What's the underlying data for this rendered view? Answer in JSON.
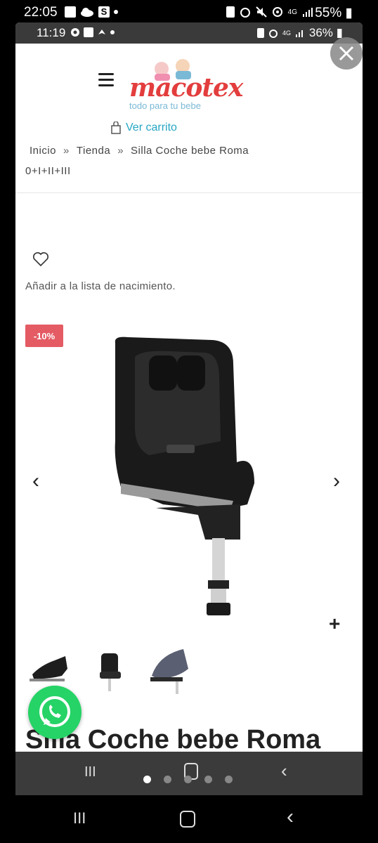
{
  "outer_status": {
    "time": "22:05",
    "battery": "55%"
  },
  "inner_status": {
    "time": "11:19",
    "battery": "36%"
  },
  "header": {
    "logo_text": "macotex",
    "logo_tagline": "todo para tu bebe",
    "cart_label": "Ver carrito"
  },
  "breadcrumb": {
    "items": [
      "Inicio",
      "Tienda",
      "Silla Coche bebe Roma 0+I+II+III"
    ],
    "separator": "»"
  },
  "wishlist": {
    "label": "Añadir a la lista de nacimiento."
  },
  "product": {
    "badge": "-10%",
    "title": "Silla Coche bebe Roma",
    "gallery_dots": 5,
    "active_dot": 0
  },
  "colors": {
    "accent": "#26a6c2",
    "badge": "#e45b64",
    "whatsapp": "#25d366",
    "logo": "#e33d3d"
  },
  "icons": [
    "menu-icon",
    "cart-icon",
    "heart-icon",
    "chevron-left-icon",
    "chevron-right-icon",
    "plus-icon",
    "whatsapp-icon",
    "close-icon"
  ]
}
